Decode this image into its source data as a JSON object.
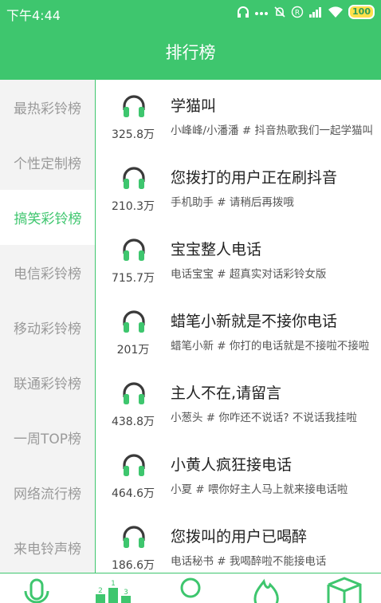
{
  "status_bar": {
    "time": "下午4:44",
    "battery": "100"
  },
  "header": {
    "title": "排行榜"
  },
  "sidebar": {
    "items": [
      {
        "label": "最热彩铃榜"
      },
      {
        "label": "个性定制榜"
      },
      {
        "label": "搞笑彩铃榜"
      },
      {
        "label": "电信彩铃榜"
      },
      {
        "label": "移动彩铃榜"
      },
      {
        "label": "联通彩铃榜"
      },
      {
        "label": "一周TOP榜"
      },
      {
        "label": "网络流行榜"
      },
      {
        "label": "来电铃声榜"
      }
    ],
    "active_index": 2
  },
  "ringtones": [
    {
      "plays": "325.8万",
      "title": "学猫叫",
      "subtitle": "小峰峰/小潘潘 # 抖音热歌我们一起学猫叫"
    },
    {
      "plays": "210.3万",
      "title": "您拨打的用户正在刷抖音",
      "subtitle": "手机助手 # 请稍后再拨哦"
    },
    {
      "plays": "715.7万",
      "title": "宝宝整人电话",
      "subtitle": "电话宝宝 # 超真实对话彩铃女版"
    },
    {
      "plays": "201万",
      "title": "蜡笔小新就是不接你电话",
      "subtitle": "蜡笔小新 # 你打的电话就是不接啦不接啦"
    },
    {
      "plays": "438.8万",
      "title": "主人不在,请留言",
      "subtitle": "小葱头 # 你咋还不说话? 不说话我挂啦"
    },
    {
      "plays": "464.6万",
      "title": "小黄人疯狂接电话",
      "subtitle": "小夏 # 喂你好主人马上就来接电话啦"
    },
    {
      "plays": "186.6万",
      "title": "您拨叫的用户已喝醉",
      "subtitle": "电话秘书 # 我喝醉啦不能接电话"
    }
  ],
  "colors": {
    "accent": "#3ec66e",
    "headphone_band": "#3a3a3a",
    "headphone_cup": "#3ec66e"
  },
  "tab_bar": {
    "icons": [
      "microphone-icon",
      "podium-icon",
      "person-icon",
      "flame-icon",
      "cube-icon"
    ]
  }
}
